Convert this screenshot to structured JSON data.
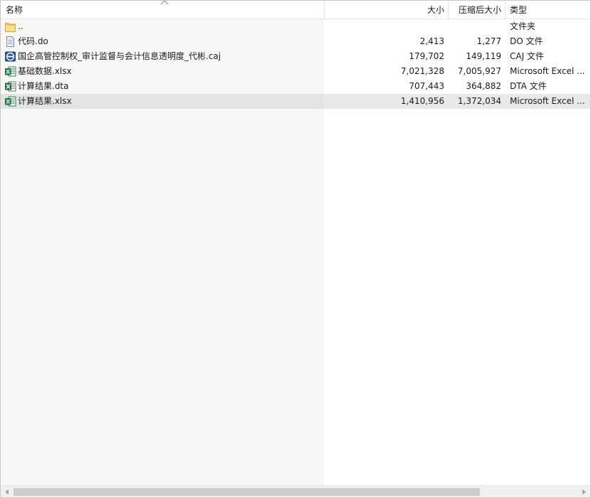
{
  "columns": {
    "name": "名称",
    "size": "大小",
    "packed": "压缩后大小",
    "type": "类型"
  },
  "files": [
    {
      "name": "..",
      "size": "",
      "packed": "",
      "type": "文件夹",
      "icon": "folder-icon"
    },
    {
      "name": "代码.do",
      "size": "2,413",
      "packed": "1,277",
      "type": "DO 文件",
      "icon": "text-file-icon"
    },
    {
      "name": "国企高管控制权_审计监督与会计信息透明度_代彬.caj",
      "size": "179,702",
      "packed": "149,119",
      "type": "CAJ 文件",
      "icon": "caj-file-icon"
    },
    {
      "name": "基础数据.xlsx",
      "size": "7,021,328",
      "packed": "7,005,927",
      "type": "Microsoft Excel ...",
      "icon": "excel-file-icon"
    },
    {
      "name": "计算结果.dta",
      "size": "707,443",
      "packed": "364,882",
      "type": "DTA 文件",
      "icon": "stata-file-icon"
    },
    {
      "name": "计算结果.xlsx",
      "size": "1,410,956",
      "packed": "1,372,034",
      "type": "Microsoft Excel ...",
      "icon": "excel-file-icon"
    }
  ],
  "selected_index": 5
}
